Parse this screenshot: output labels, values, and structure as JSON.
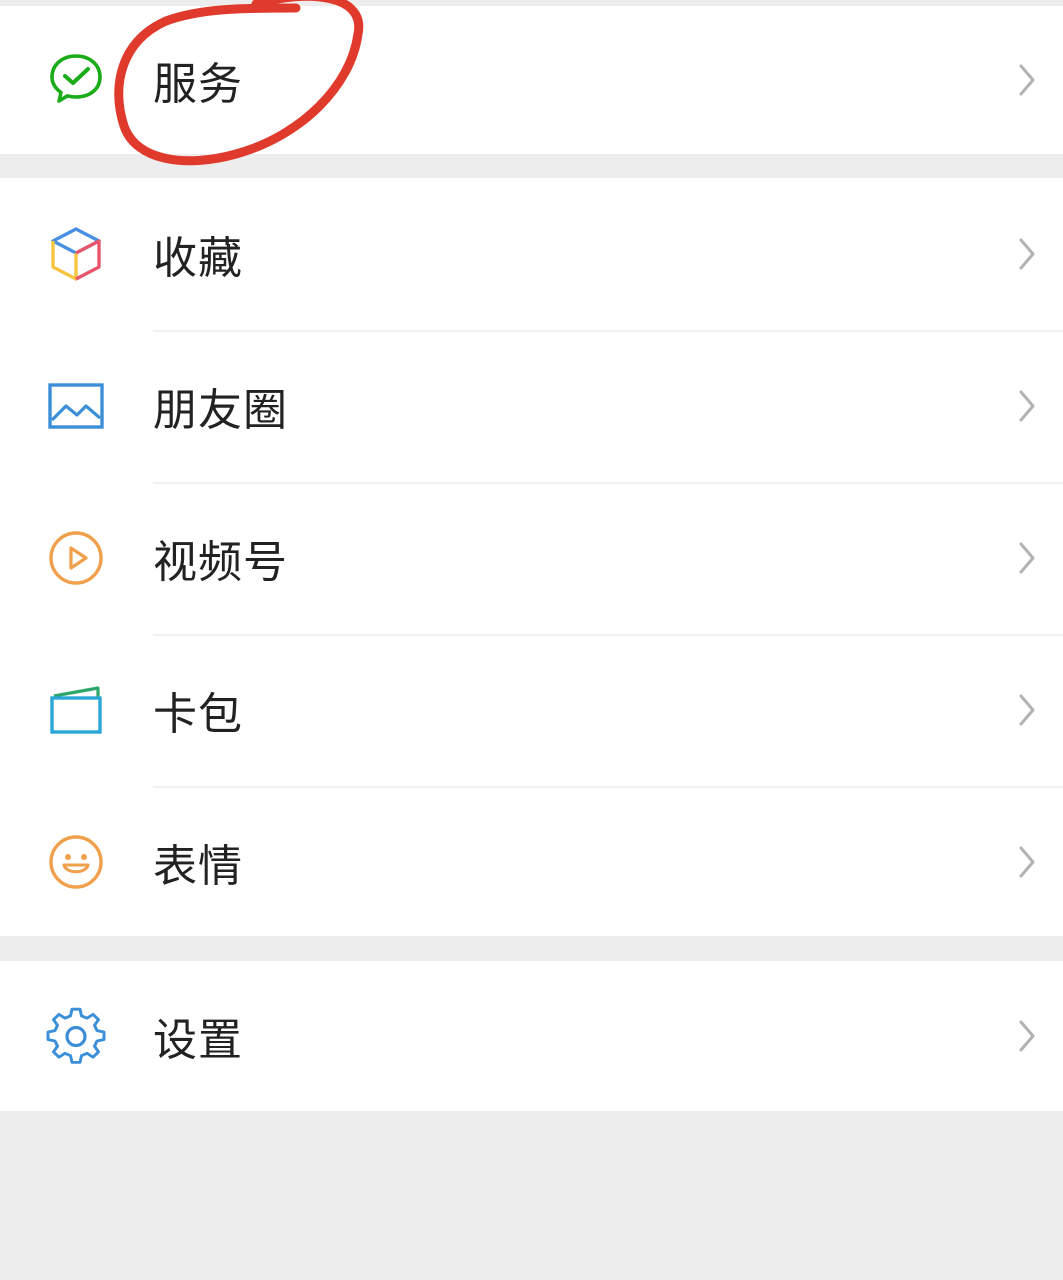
{
  "menu": {
    "items": [
      {
        "label": "服务",
        "icon": "wechat-pay-icon",
        "icon_color": "#1aad19"
      },
      {
        "label": "收藏",
        "icon": "favorites-cube-icon",
        "icon_color": "#4a90e2"
      },
      {
        "label": "朋友圈",
        "icon": "moments-image-icon",
        "icon_color": "#3b8fd9"
      },
      {
        "label": "视频号",
        "icon": "channels-play-icon",
        "icon_color": "#f0a04b"
      },
      {
        "label": "卡包",
        "icon": "card-wallet-icon",
        "icon_color": "#2aa7d8"
      },
      {
        "label": "表情",
        "icon": "sticker-smile-icon",
        "icon_color": "#f0a04b"
      },
      {
        "label": "设置",
        "icon": "settings-gear-icon",
        "icon_color": "#3b8fd9"
      }
    ]
  },
  "annotation": {
    "type": "hand-drawn-circle",
    "target": "服务",
    "color": "#e03a2c"
  }
}
